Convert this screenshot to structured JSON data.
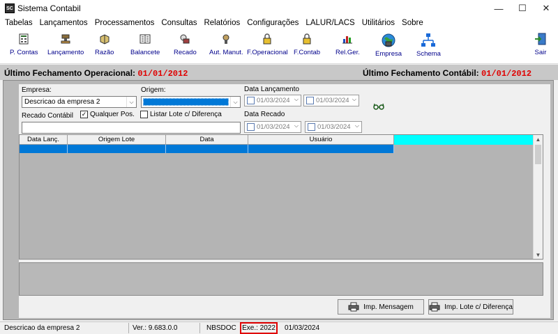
{
  "window": {
    "title": "Sistema Contabil",
    "app_icon_text": "SC",
    "minimize": "—",
    "maximize": "☐",
    "close": "✕"
  },
  "menu": [
    "Tabelas",
    "Lançamentos",
    "Processamentos",
    "Consultas",
    "Relatórios",
    "Configurações",
    "LALUR/LACS",
    "Utilitários",
    "Sobre"
  ],
  "toolbar": {
    "p_contas": "P. Contas",
    "lancamento": "Lançamento",
    "razao": "Razão",
    "balancete": "Balancete",
    "recado": "Recado",
    "aut_manut": "Aut. Manut.",
    "f_operacional": "F.Operacional",
    "f_contab": "F.Contab",
    "rel_ger": "Rel.Ger.",
    "empresa": "Empresa",
    "schema": "Schema",
    "sair": "Sair"
  },
  "header": {
    "op_label": "Último Fechamento Operacional:",
    "op_date": "01/01/2012",
    "cont_label": "Último Fechamento Contábil:",
    "cont_date": "01/01/2012"
  },
  "filters": {
    "empresa_label": "Empresa:",
    "empresa_value": "Descricao da empresa 2",
    "origem_label": "Origem:",
    "data_lancamento_label": "Data Lançamento",
    "data_lanc_from": "01/03/2024",
    "data_lanc_to": "01/03/2024",
    "recado_label": "Recado Contábil",
    "qualquer_pos_label": "Qualquer Pos.",
    "qualquer_pos_checked": "✓",
    "listar_lote_label": "Listar Lote c/ Diferença",
    "data_recado_label": "Data Recado",
    "data_rec_from": "01/03/2024",
    "data_rec_to": "01/03/2024"
  },
  "grid": {
    "columns": [
      "Data Lanç.",
      "Origem Lote",
      "Data",
      "Usuário"
    ],
    "rows": [
      [
        "",
        "",
        "",
        ""
      ]
    ]
  },
  "buttons": {
    "imp_mensagem": "Imp. Mensagem",
    "imp_lote": "Imp. Lote c/ Diferença"
  },
  "status": {
    "empresa": "Descricao da empresa 2",
    "versao": "Ver.: 9.683.0.0",
    "nbsdoc": "NBSDOC",
    "exe": "Exe.: 2022",
    "date": "01/03/2024"
  },
  "colors": {
    "accent_blue": "#0078d7",
    "date_red": "#e00000",
    "cyan": "#00ffff",
    "label_navy": "#00008b"
  }
}
